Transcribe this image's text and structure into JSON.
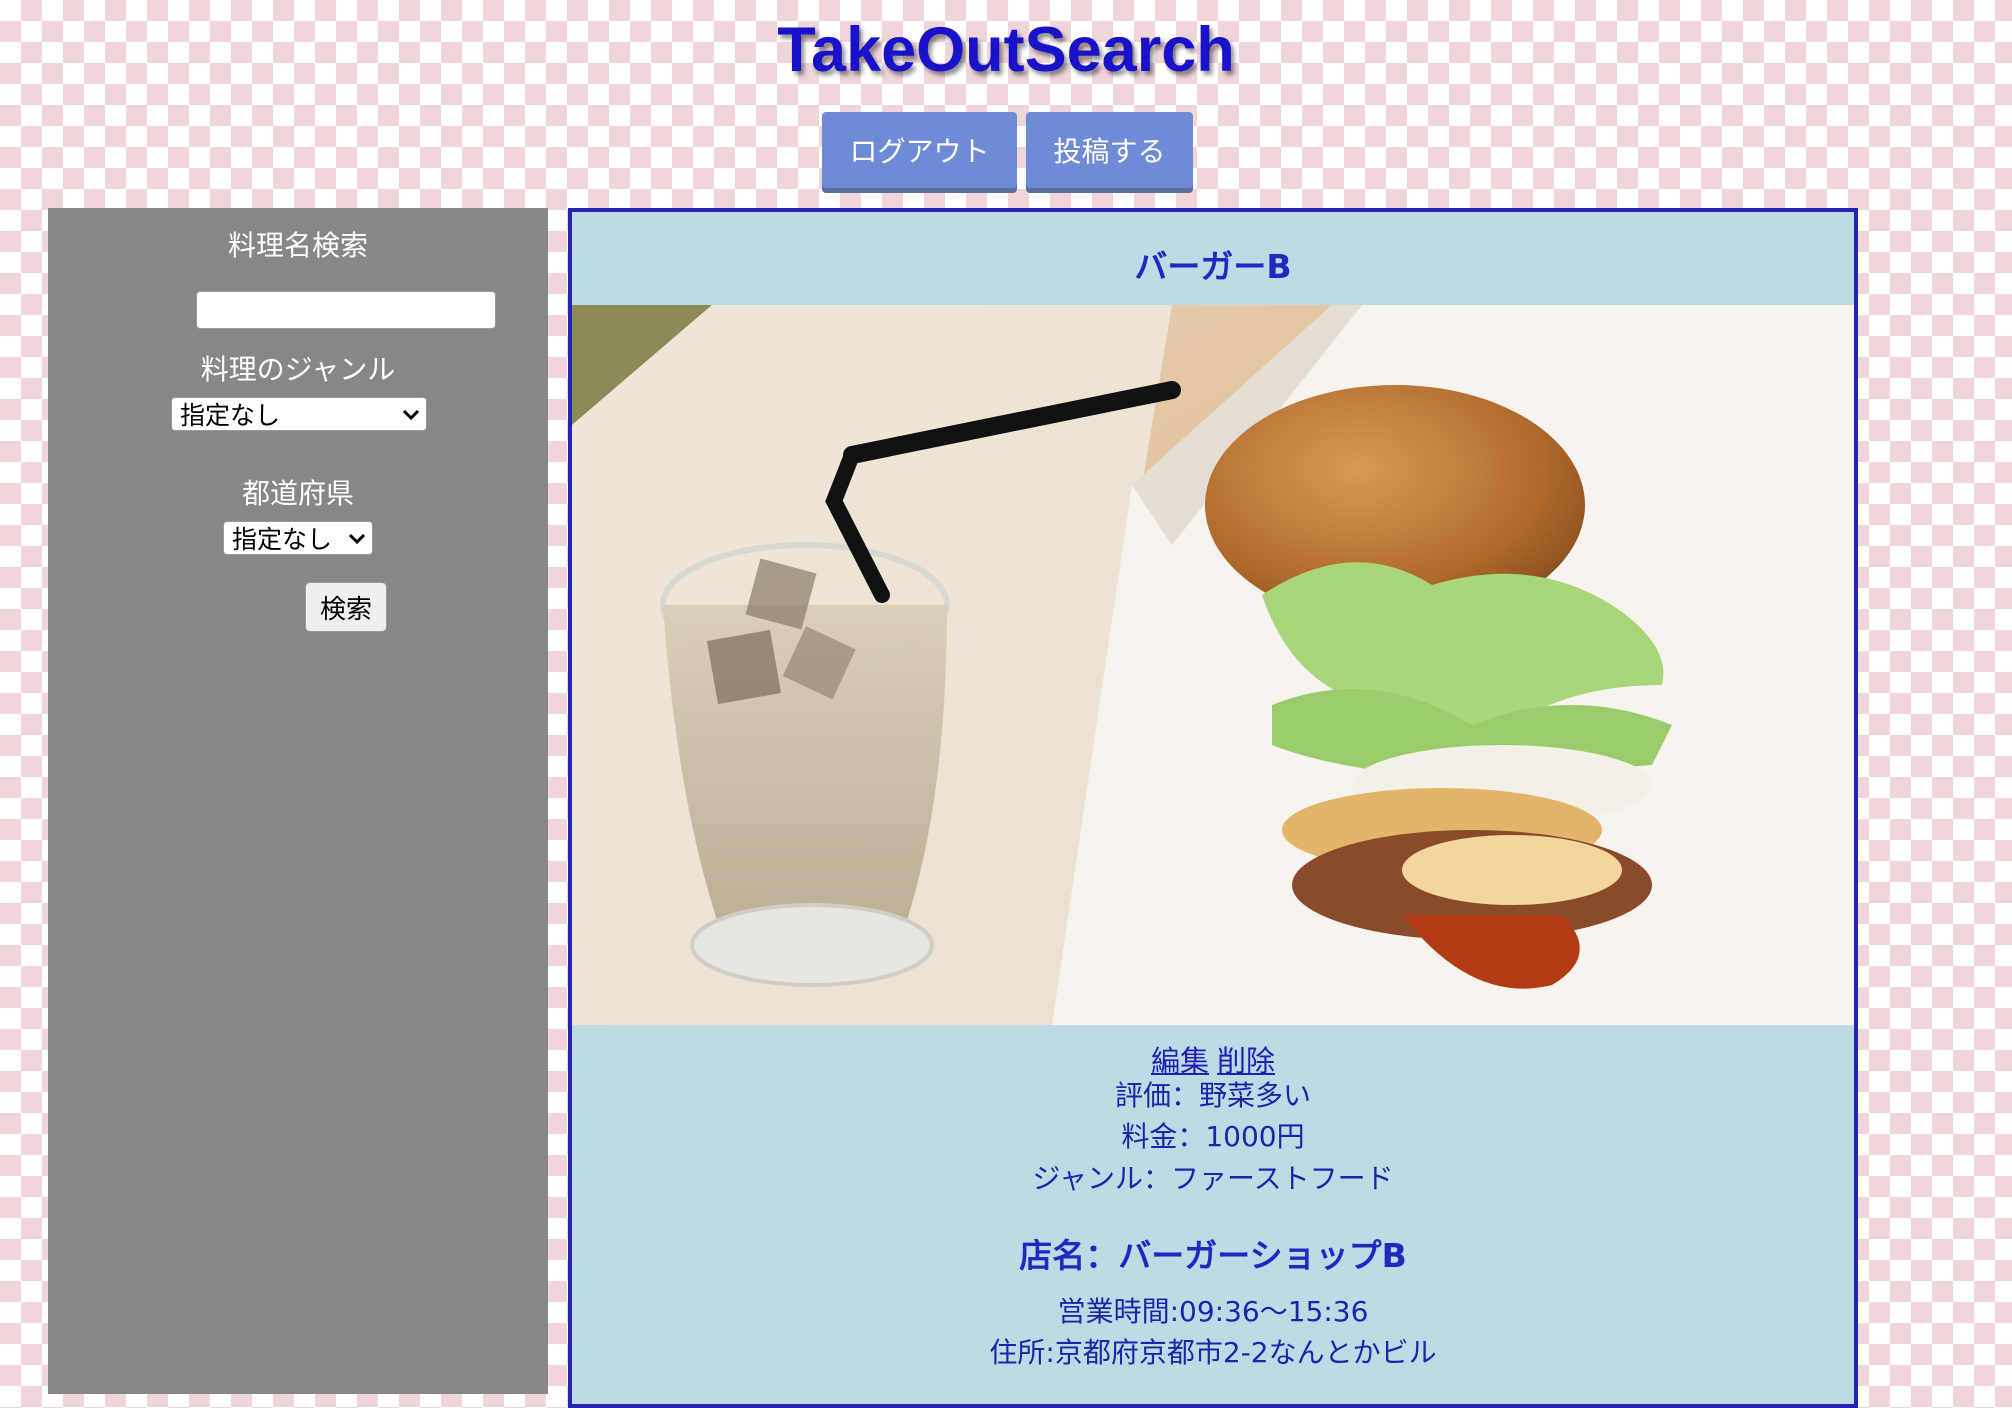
{
  "header": {
    "title": "TakeOutSearch",
    "logout_label": "ログアウト",
    "post_label": "投稿する"
  },
  "sidebar": {
    "name_search_label": "料理名検索",
    "name_search_value": "",
    "genre_label": "料理のジャンル",
    "genre_selected": "指定なし",
    "prefecture_label": "都道府県",
    "prefecture_selected": "指定なし",
    "search_button": "検索"
  },
  "post": {
    "title": "バーガーB",
    "edit_link": "編集",
    "delete_link": "削除",
    "rating": "評価：野菜多い",
    "price": "料金：1000円",
    "genre": "ジャンル：ファーストフード",
    "shop_name": "店名：バーガーショップB",
    "hours": "営業時間:09:36〜15:36",
    "address": "住所:京都府京都市2-2なんとかビル"
  },
  "colors": {
    "title_blue": "#1a12c8",
    "nav_button": "#6f8bd6",
    "sidebar_gray": "#878787",
    "card_bg": "#bddbe4",
    "card_border": "#2424b4"
  },
  "icons": {
    "select_arrow": "chevron-down-icon"
  }
}
